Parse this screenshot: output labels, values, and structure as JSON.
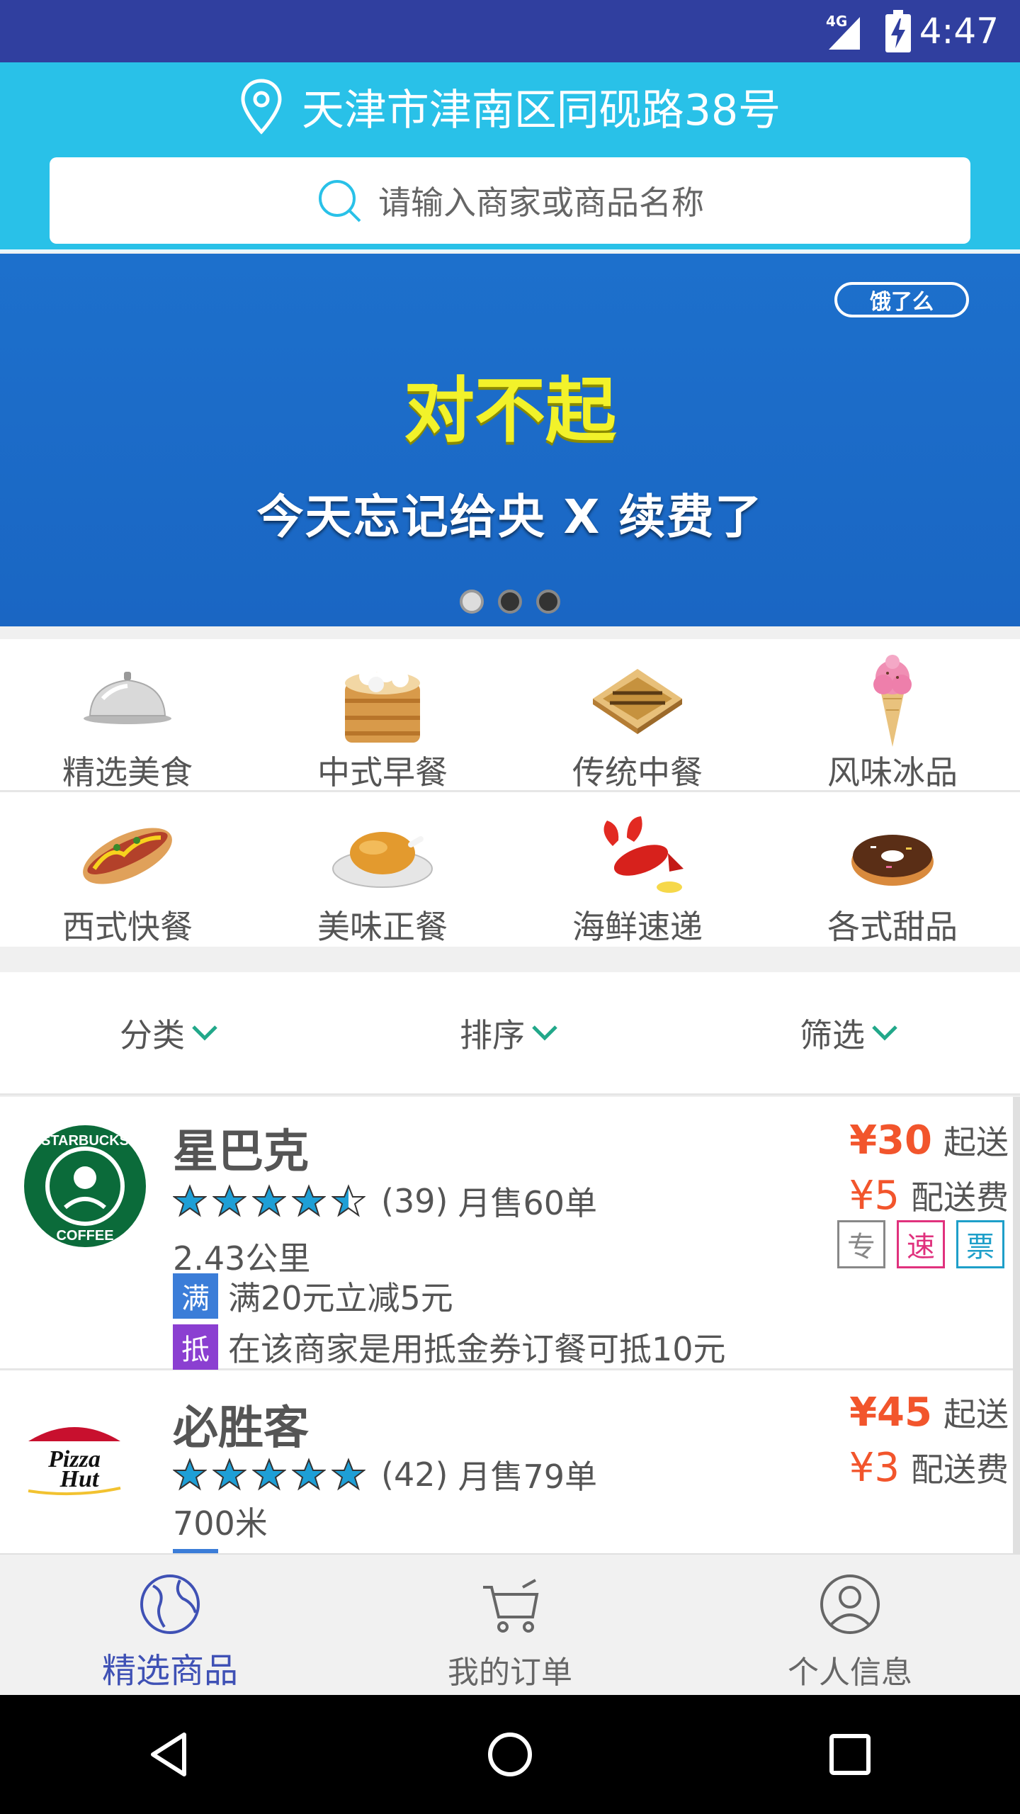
{
  "status_bar": {
    "time": "4:47",
    "network": "4G"
  },
  "header": {
    "location": "天津市津南区同砚路38号",
    "search_placeholder": "请输入商家或商品名称"
  },
  "banner": {
    "brand": "饿了么",
    "headline": "对不起",
    "subline": "今天忘记给央 X 续费了",
    "slides": 3,
    "active_slide": 1
  },
  "categories": [
    {
      "label": "精选美食",
      "icon": "cloche-icon"
    },
    {
      "label": "中式早餐",
      "icon": "steamer-icon"
    },
    {
      "label": "传统中餐",
      "icon": "pastry-icon"
    },
    {
      "label": "风味冰品",
      "icon": "ice-cream-icon"
    },
    {
      "label": "西式快餐",
      "icon": "hotdog-icon"
    },
    {
      "label": "美味正餐",
      "icon": "roast-chicken-icon"
    },
    {
      "label": "海鲜速递",
      "icon": "lobster-icon"
    },
    {
      "label": "各式甜品",
      "icon": "donut-icon"
    }
  ],
  "filters": [
    {
      "label": "分类"
    },
    {
      "label": "排序"
    },
    {
      "label": "筛选"
    }
  ],
  "shops": [
    {
      "name": "星巴克",
      "logo": "starbucks-logo",
      "rating": 4.5,
      "reviews": "(39)",
      "monthly_sales": "月售60单",
      "distance": "2.43公里",
      "min_order": "¥30",
      "min_order_label": "起送",
      "delivery_fee": "¥5",
      "delivery_fee_label": "配送费",
      "badges": [
        "专",
        "速",
        "票"
      ],
      "promos": [
        {
          "tag": "满",
          "text": "满20元立减5元"
        },
        {
          "tag": "抵",
          "text": "在该商家是用抵金券订餐可抵10元"
        }
      ]
    },
    {
      "name": "必胜客",
      "logo": "pizza-hut-logo",
      "rating": 5,
      "reviews": "(42)",
      "monthly_sales": "月售79单",
      "distance": "700米",
      "min_order": "¥45",
      "min_order_label": "起送",
      "delivery_fee": "¥3",
      "delivery_fee_label": "配送费"
    }
  ],
  "tabs": [
    {
      "label": "精选商品",
      "icon": "globe-icon",
      "active": true
    },
    {
      "label": "我的订单",
      "icon": "cart-icon",
      "active": false
    },
    {
      "label": "个人信息",
      "icon": "user-icon",
      "active": false
    }
  ],
  "colors": {
    "status_bar": "#303f9f",
    "header": "#29c1e8",
    "price": "#f2552c",
    "active_tab": "#3f51b5"
  }
}
